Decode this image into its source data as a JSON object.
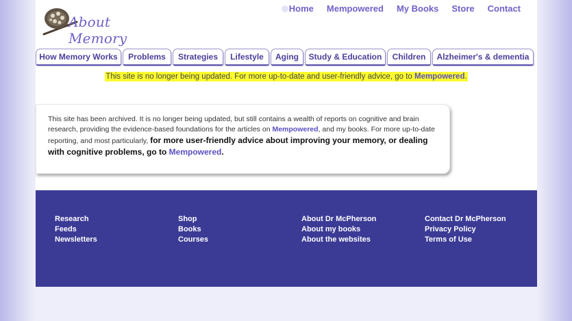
{
  "logo": {
    "text": "About Memory"
  },
  "top_nav": [
    {
      "label": "Home"
    },
    {
      "label": "Mempowered"
    },
    {
      "label": "My Books"
    },
    {
      "label": "Store"
    },
    {
      "label": "Contact"
    }
  ],
  "tabs": [
    {
      "label": "How Memory Works"
    },
    {
      "label": "Problems"
    },
    {
      "label": "Strategies"
    },
    {
      "label": "Lifestyle"
    },
    {
      "label": "Aging"
    },
    {
      "label": "Study & Education"
    },
    {
      "label": "Children"
    },
    {
      "label": "Alzheimer's & dementia"
    }
  ],
  "notice": {
    "text": "This site is no longer being updated. For more up-to-date and user-friendly advice, go to ",
    "link": "Mempowered",
    "end": "."
  },
  "card": {
    "part1": "This site has been archived. It is no longer being updated, but still contains a wealth of reports on cognitive and brain research, providing the evidence-based foundations for the articles on ",
    "link1": "Mempowered",
    "part2": ", and my books. For more up-to-date reporting, and most particularly, ",
    "strong": "for more user-friendly advice about improving your memory, or dealing with cognitive problems, go to ",
    "link2": "Mempowered",
    "end": "."
  },
  "footer": {
    "col1": [
      "Research",
      "Feeds",
      "Newsletters"
    ],
    "col2": [
      "Shop",
      "Books",
      "Courses"
    ],
    "col3": [
      "About Dr McPherson",
      "About my books",
      "About the websites"
    ],
    "col4": [
      "Contact Dr McPherson",
      "Privacy Policy",
      "Terms of Use"
    ]
  },
  "colors": {
    "brand_purple": "#6f62c8",
    "footer_bg": "#3b3b96",
    "notice_highlight": "#fbfb2e"
  }
}
